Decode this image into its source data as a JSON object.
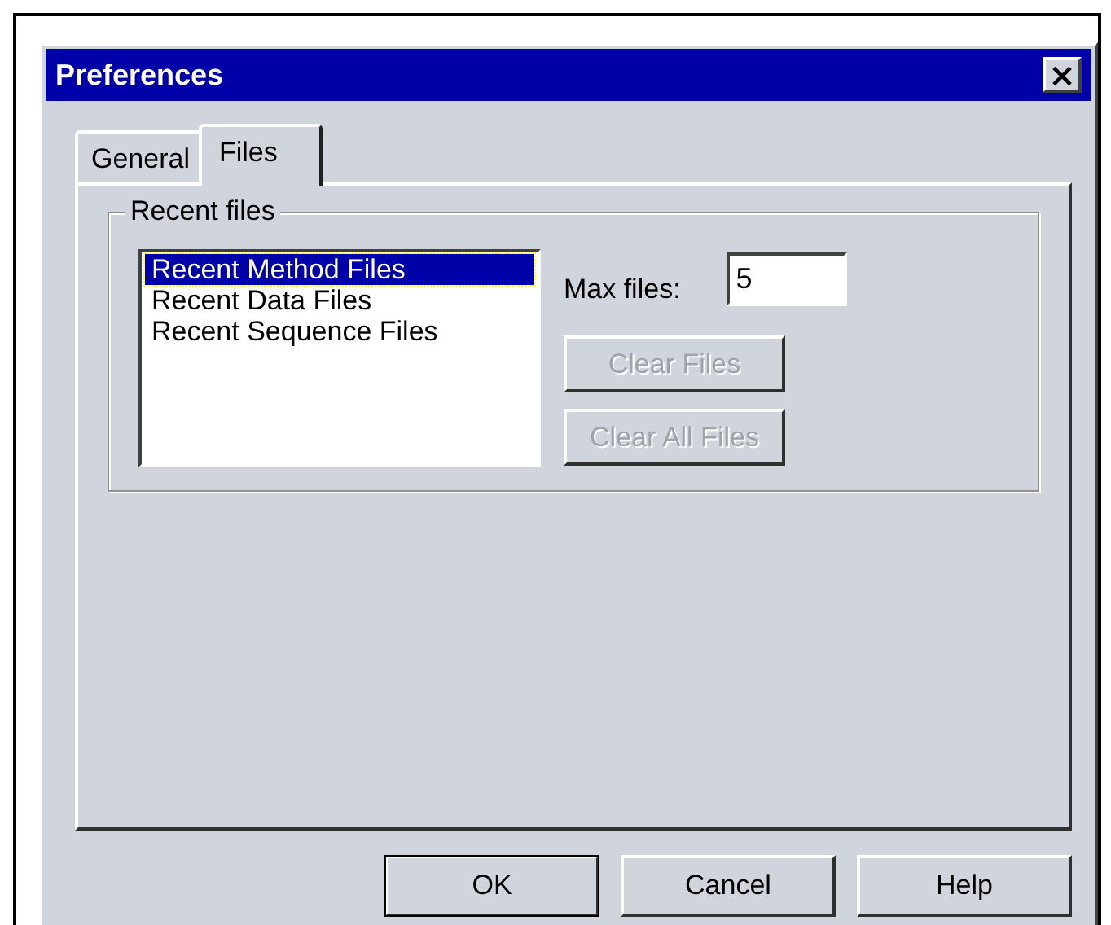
{
  "window": {
    "title": "Preferences",
    "close": "×"
  },
  "tabs": [
    {
      "label": "General",
      "selected": false
    },
    {
      "label": "Files",
      "selected": true
    }
  ],
  "group": {
    "title": "Recent files",
    "list": [
      {
        "label": "Recent Method Files",
        "selected": true
      },
      {
        "label": "Recent Data Files",
        "selected": false
      },
      {
        "label": "Recent Sequence Files",
        "selected": false
      }
    ],
    "max_files": {
      "label": "Max files:",
      "value": "5"
    },
    "actions": [
      {
        "label": "Clear Files",
        "disabled": true
      },
      {
        "label": "Clear All Files",
        "disabled": true
      }
    ]
  },
  "buttons": [
    {
      "label": "OK",
      "default": true
    },
    {
      "label": "Cancel",
      "default": false
    },
    {
      "label": "Help",
      "default": false
    }
  ]
}
